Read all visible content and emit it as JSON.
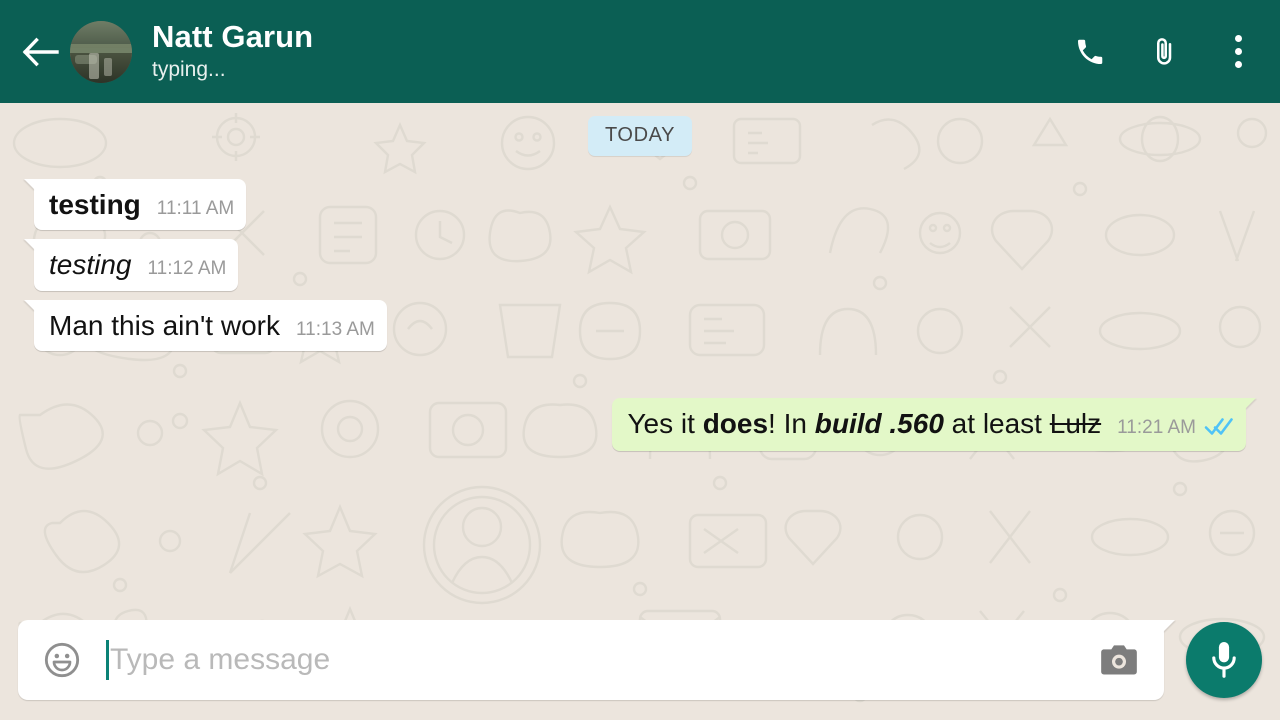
{
  "header": {
    "back_icon": "back-arrow-icon",
    "avatar_label": "contact-avatar",
    "contact_name": "Natt Garun",
    "status": "typing...",
    "call_icon": "phone-icon",
    "attach_icon": "paperclip-icon",
    "menu_icon": "overflow-menu-icon",
    "bg_color": "#0b5f54"
  },
  "chat": {
    "background_color": "#ece5dd",
    "day_divider": "TODAY",
    "day_divider_color": "#d3ecf7",
    "incoming_bubble_color": "#ffffff",
    "outgoing_bubble_color": "#e3f8c8",
    "read_tick_color": "#4fc3f7",
    "messages": [
      {
        "id": "m1",
        "direction": "in",
        "text": "testing",
        "style": "bold",
        "time": "11:11 AM"
      },
      {
        "id": "m2",
        "direction": "in",
        "text": "testing",
        "style": "italic",
        "time": "11:12 AM"
      },
      {
        "id": "m3",
        "direction": "in",
        "text": "Man this ain't work",
        "style": "regular",
        "time": "11:13 AM"
      },
      {
        "id": "m4",
        "direction": "out",
        "text": "Yes it does! In build .560 at least Lulz",
        "style": "mixed",
        "time": "11:21 AM",
        "status": "read",
        "rich": [
          {
            "t": "Yes it ",
            "f": "regular"
          },
          {
            "t": "does",
            "f": "bold"
          },
          {
            "t": "! In ",
            "f": "regular"
          },
          {
            "t": "build .560",
            "f": "bold-italic"
          },
          {
            "t": " at least ",
            "f": "regular"
          },
          {
            "t": "Lulz",
            "f": "strikethrough"
          }
        ]
      }
    ]
  },
  "composer": {
    "emoji_icon": "emoji-smiley-icon",
    "placeholder": "Type a message",
    "input_value": "",
    "camera_icon": "camera-icon",
    "mic_icon": "microphone-icon",
    "mic_button_color": "#0b7b6c"
  }
}
